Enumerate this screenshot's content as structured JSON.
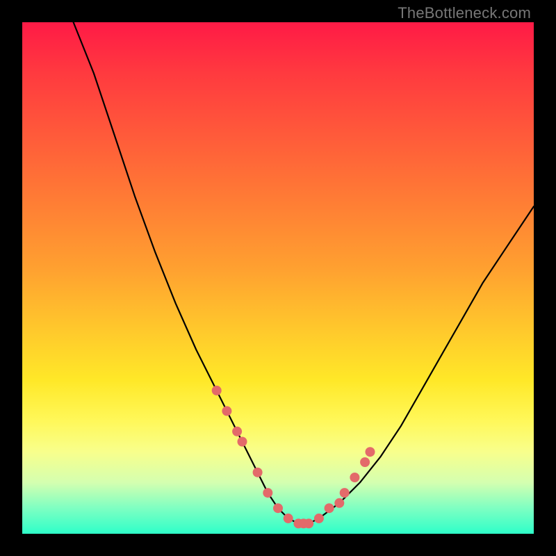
{
  "watermark": "TheBottleneck.com",
  "colors": {
    "frame": "#000000",
    "curve": "#000000",
    "marker": "#e36a6a",
    "gradient_top": "#ff1a46",
    "gradient_bottom": "#2effc9"
  },
  "chart_data": {
    "type": "line",
    "title": "",
    "xlabel": "",
    "ylabel": "",
    "xlim": [
      0,
      100
    ],
    "ylim": [
      0,
      100
    ],
    "series": [
      {
        "name": "bottleneck-curve",
        "x": [
          10,
          14,
          18,
          22,
          26,
          30,
          34,
          38,
          42,
          46,
          48,
          50,
          52,
          54,
          56,
          58,
          62,
          66,
          70,
          74,
          78,
          82,
          86,
          90,
          94,
          98,
          100
        ],
        "y": [
          100,
          90,
          78,
          66,
          55,
          45,
          36,
          28,
          20,
          12,
          8,
          5,
          3,
          2,
          2,
          3,
          6,
          10,
          15,
          21,
          28,
          35,
          42,
          49,
          55,
          61,
          64
        ]
      }
    ],
    "markers": {
      "name": "highlight-points",
      "x": [
        38,
        40,
        42,
        43,
        46,
        48,
        50,
        52,
        54,
        55,
        56,
        58,
        60,
        62,
        63,
        65,
        67,
        68
      ],
      "y": [
        28,
        24,
        20,
        18,
        12,
        8,
        5,
        3,
        2,
        2,
        2,
        3,
        5,
        6,
        8,
        11,
        14,
        16
      ]
    }
  }
}
